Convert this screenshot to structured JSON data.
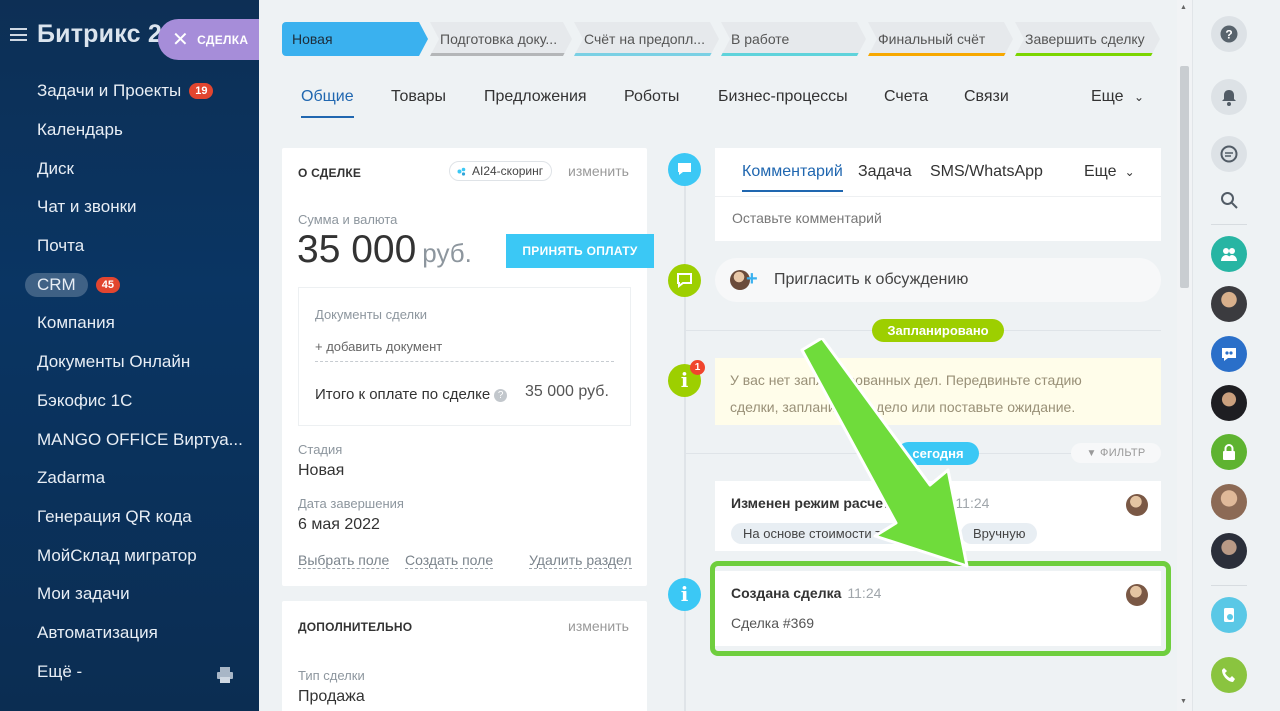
{
  "sidebar": {
    "title": "Битрикс 2",
    "items": [
      {
        "label": "Задачи и Проекты",
        "badge": "19"
      },
      {
        "label": "Календарь",
        "badge": ""
      },
      {
        "label": "Диск",
        "badge": ""
      },
      {
        "label": "Чат и звонки",
        "badge": ""
      },
      {
        "label": "Почта",
        "badge": ""
      },
      {
        "label": "CRM",
        "badge": "45"
      },
      {
        "label": "Компания",
        "badge": ""
      },
      {
        "label": "Документы Онлайн",
        "badge": ""
      },
      {
        "label": "Бэкофис 1С",
        "badge": ""
      },
      {
        "label": "MANGO OFFICE Виртуа...",
        "badge": ""
      },
      {
        "label": "Zadarma",
        "badge": ""
      },
      {
        "label": "Генерация QR кода",
        "badge": ""
      },
      {
        "label": "МойСклад мигратор",
        "badge": ""
      },
      {
        "label": "Мои задачи",
        "badge": ""
      },
      {
        "label": "Автоматизация",
        "badge": ""
      },
      {
        "label": "Ещё -",
        "badge": ""
      }
    ]
  },
  "close_button": "СДЕЛКА",
  "stages": [
    {
      "label": "Новая",
      "color": "#3ab1ef"
    },
    {
      "label": "Подготовка доку...",
      "color": "#b4b6b8"
    },
    {
      "label": "Счёт на предопл...",
      "color": "#7ad0e4"
    },
    {
      "label": "В работе",
      "color": "#5fd3db"
    },
    {
      "label": "Финальный счёт",
      "color": "#f7a800"
    },
    {
      "label": "Завершить сделку",
      "color": "#7bd500"
    }
  ],
  "tabs": [
    "Общие",
    "Товары",
    "Предложения",
    "Роботы",
    "Бизнес-процессы",
    "Счета",
    "Связи",
    "Еще"
  ],
  "deal": {
    "header": "О СДЕЛКЕ",
    "ai_chip": "AI24-скоринг",
    "change": "изменить",
    "amount_label": "Сумма и валюта",
    "amount": "35 000",
    "currency": "руб.",
    "pay_button": "ПРИНЯТЬ ОПЛАТУ",
    "docs_title": "Документы сделки",
    "add_doc": "+ добавить документ",
    "total_label": "Итого к оплате по сделке",
    "total_value": "35 000 руб.",
    "stage_label": "Стадия",
    "stage_value": "Новая",
    "date_label": "Дата завершения",
    "date_value": "6 мая 2022",
    "link_select": "Выбрать поле",
    "link_create": "Создать поле",
    "link_delete": "Удалить раздел"
  },
  "extra": {
    "header": "ДОПОЛНИТЕЛЬНО",
    "change": "изменить",
    "type_label": "Тип сделки",
    "type_value": "Продажа"
  },
  "comment_box": {
    "tabs": [
      "Комментарий",
      "Задача",
      "SMS/WhatsApp",
      "Еще"
    ],
    "placeholder": "Оставьте комментарий"
  },
  "invite": "Пригласить к обсуждению",
  "planned_pill": "Запланировано",
  "no_tasks": "У вас нет запланированных дел. Передвиньте стадию сделки, запланируйте дело или поставьте ожидание.",
  "today_pill": "сегодня",
  "filter": "ФИЛЬТР",
  "events": [
    {
      "title": "Изменен режим расчета суммы",
      "time": "11:24",
      "from": "На основе стоимости товаров",
      "to": "Вручную"
    },
    {
      "title": "Создана сделка",
      "time": "11:24",
      "sub": "Сделка #369"
    }
  ],
  "notif_count": "1",
  "colors": {
    "accent": "#2067b0",
    "highlight": "#6fce3e",
    "blue": "#3bc8f5",
    "green": "#9dcf00"
  }
}
